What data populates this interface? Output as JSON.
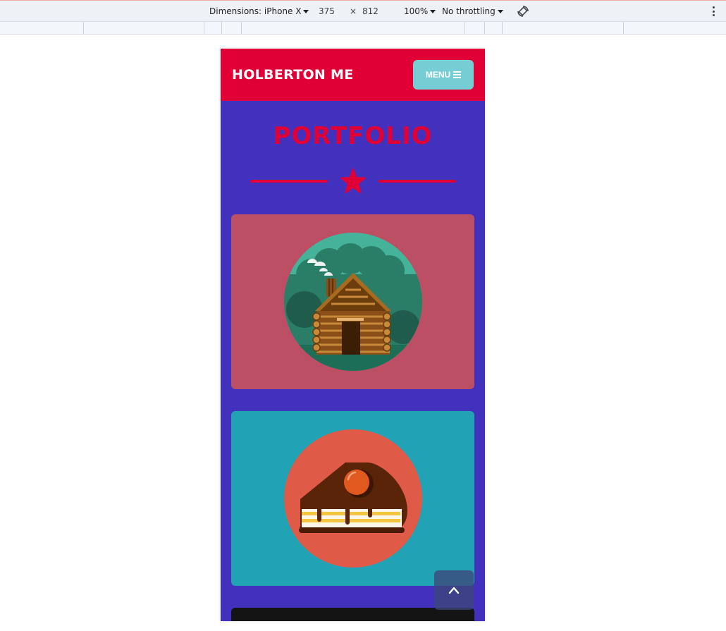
{
  "devtools": {
    "dimensions_label": "Dimensions: iPhone X",
    "width": "375",
    "times": "×",
    "height": "812",
    "zoom": "100%",
    "throttling": "No throttling",
    "icons": [
      "chevron-down-icon",
      "rotate-icon",
      "more-vert-icon"
    ]
  },
  "site": {
    "brand": "HOLBERTON ME",
    "menu_label": "MENU",
    "menu_icon": "bars-icon",
    "section_title": "PORTFOLIO",
    "divider_icon": "star-icon",
    "scroll_top_icon": "chevron-up-icon"
  },
  "portfolio": {
    "items": [
      {
        "image": "log-cabin-illustration",
        "background": "#bc4f64"
      },
      {
        "image": "chocolate-cake-slice-illustration",
        "background": "#21a3b5"
      },
      {
        "image": "dark-card",
        "background": "#141414"
      }
    ]
  },
  "colors": {
    "header": "#e10036",
    "page_background": "#4231bc",
    "menu_button": "#76cdd4",
    "accent": "#e10036"
  }
}
